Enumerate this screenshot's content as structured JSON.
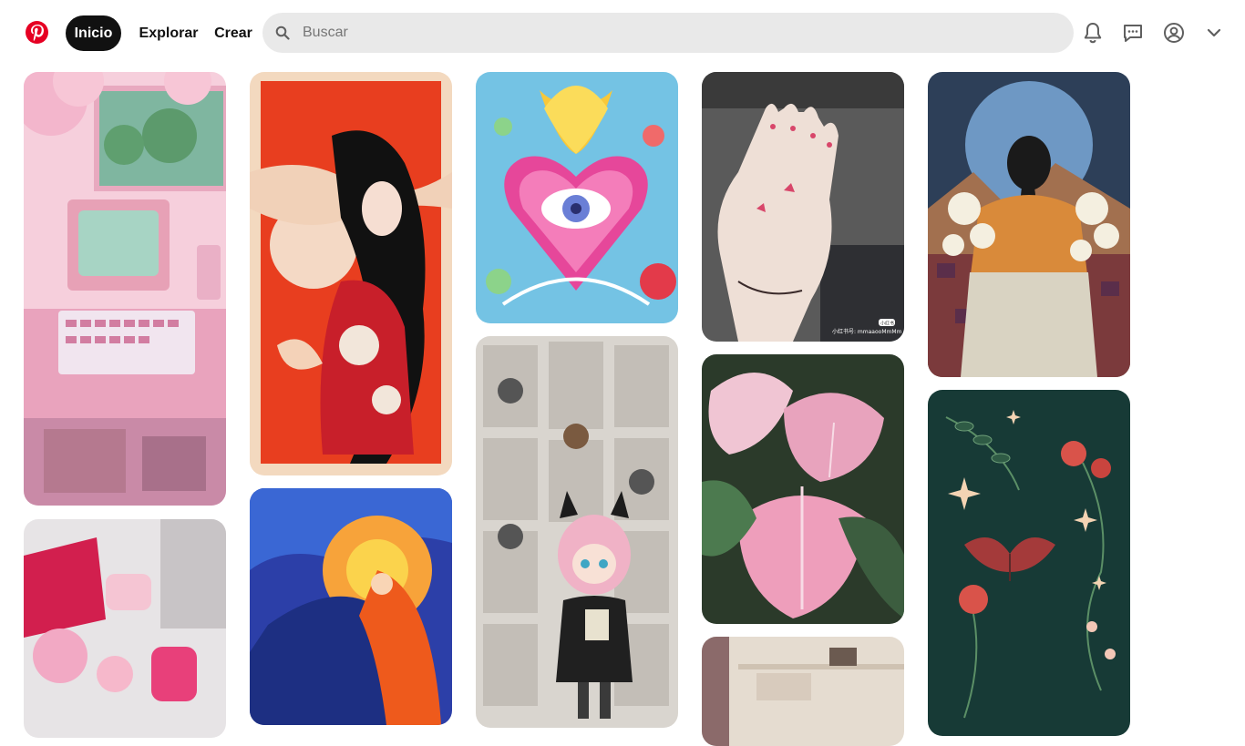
{
  "header": {
    "nav": {
      "home_label": "Inicio",
      "explore_label": "Explorar",
      "create_label": "Crear"
    },
    "search": {
      "placeholder": "Buscar",
      "value": ""
    },
    "icons": {
      "logo": "pinterest-logo-icon",
      "notifications": "bell-icon",
      "messages": "chat-icon",
      "profile": "user-circle-icon",
      "more": "chevron-down-icon"
    },
    "colors": {
      "brand": "#e60023",
      "active_nav_bg": "#111111",
      "search_bg": "#e9e9e9"
    }
  },
  "pins": {
    "pin_4_caption": "小红书号: mmaaooMmMm",
    "pin_4_badge": "小红书"
  }
}
